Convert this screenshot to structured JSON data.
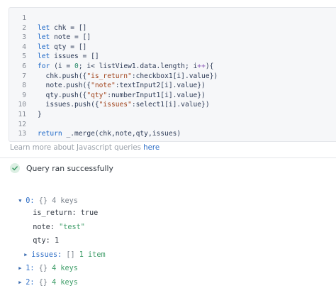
{
  "editor": {
    "lines": [
      {
        "n": "1",
        "tokens": []
      },
      {
        "n": "2",
        "tokens": [
          {
            "t": "let ",
            "c": "t-kw"
          },
          {
            "t": "chk = []",
            "c": "t-id"
          }
        ]
      },
      {
        "n": "3",
        "tokens": [
          {
            "t": "let ",
            "c": "t-kw"
          },
          {
            "t": "note = []",
            "c": "t-id"
          }
        ]
      },
      {
        "n": "4",
        "tokens": [
          {
            "t": "let ",
            "c": "t-kw"
          },
          {
            "t": "qty = []",
            "c": "t-id"
          }
        ]
      },
      {
        "n": "5",
        "tokens": [
          {
            "t": "let ",
            "c": "t-kw"
          },
          {
            "t": "issues = []",
            "c": "t-id"
          }
        ]
      },
      {
        "n": "6",
        "tokens": [
          {
            "t": "for ",
            "c": "t-kw"
          },
          {
            "t": "(i = ",
            "c": "t-pl"
          },
          {
            "t": "0",
            "c": "t-num"
          },
          {
            "t": "; i< listView1.data.length; i",
            "c": "t-pl"
          },
          {
            "t": "++",
            "c": "t-op"
          },
          {
            "t": "){",
            "c": "t-pl"
          }
        ]
      },
      {
        "n": "7",
        "tokens": [
          {
            "t": "  chk.push({",
            "c": "t-pl"
          },
          {
            "t": "\"is_return\"",
            "c": "t-str"
          },
          {
            "t": ":checkbox1[i].value})",
            "c": "t-pl"
          }
        ]
      },
      {
        "n": "8",
        "tokens": [
          {
            "t": "  note.push({",
            "c": "t-pl"
          },
          {
            "t": "\"note\"",
            "c": "t-str"
          },
          {
            "t": ":textInput2[i].value})",
            "c": "t-pl"
          }
        ]
      },
      {
        "n": "9",
        "tokens": [
          {
            "t": "  qty.push({",
            "c": "t-pl"
          },
          {
            "t": "\"qty\"",
            "c": "t-str"
          },
          {
            "t": ":numberInput1[i].value})",
            "c": "t-pl"
          }
        ]
      },
      {
        "n": "10",
        "tokens": [
          {
            "t": "  issues.push({",
            "c": "t-pl"
          },
          {
            "t": "\"issues\"",
            "c": "t-str"
          },
          {
            "t": ":select1[i].value})",
            "c": "t-pl"
          }
        ]
      },
      {
        "n": "11",
        "tokens": [
          {
            "t": "}",
            "c": "t-pl"
          }
        ]
      },
      {
        "n": "12",
        "tokens": []
      },
      {
        "n": "13",
        "tokens": [
          {
            "t": "return ",
            "c": "t-kw"
          },
          {
            "t": "_.merge(chk,note,qty,issues)",
            "c": "t-pl"
          }
        ]
      }
    ]
  },
  "learn_more": {
    "text": "Learn more about Javascript queries ",
    "link": "here"
  },
  "status": {
    "text": "Query ran successfully"
  },
  "result": {
    "item0": {
      "index": "0:",
      "braces": "{}",
      "count": "4 keys"
    },
    "fields": [
      {
        "key": "is_return:",
        "value": "true"
      },
      {
        "key": "note:",
        "value": "\"test\""
      },
      {
        "key": "qty:",
        "value": "1"
      }
    ],
    "issues": {
      "key": "issues:",
      "brackets": "[]",
      "count": "1 item"
    },
    "item1": {
      "index": "1:",
      "braces": "{}",
      "count": "4 keys"
    },
    "item2": {
      "index": "2:",
      "braces": "{}",
      "count": "4 keys"
    }
  },
  "colors": {
    "editor_bg": "#f6f7f9",
    "keyword": "#1c67c7",
    "string": "#a0421a",
    "link": "#2f6fc7",
    "success": "#3e9d68"
  }
}
